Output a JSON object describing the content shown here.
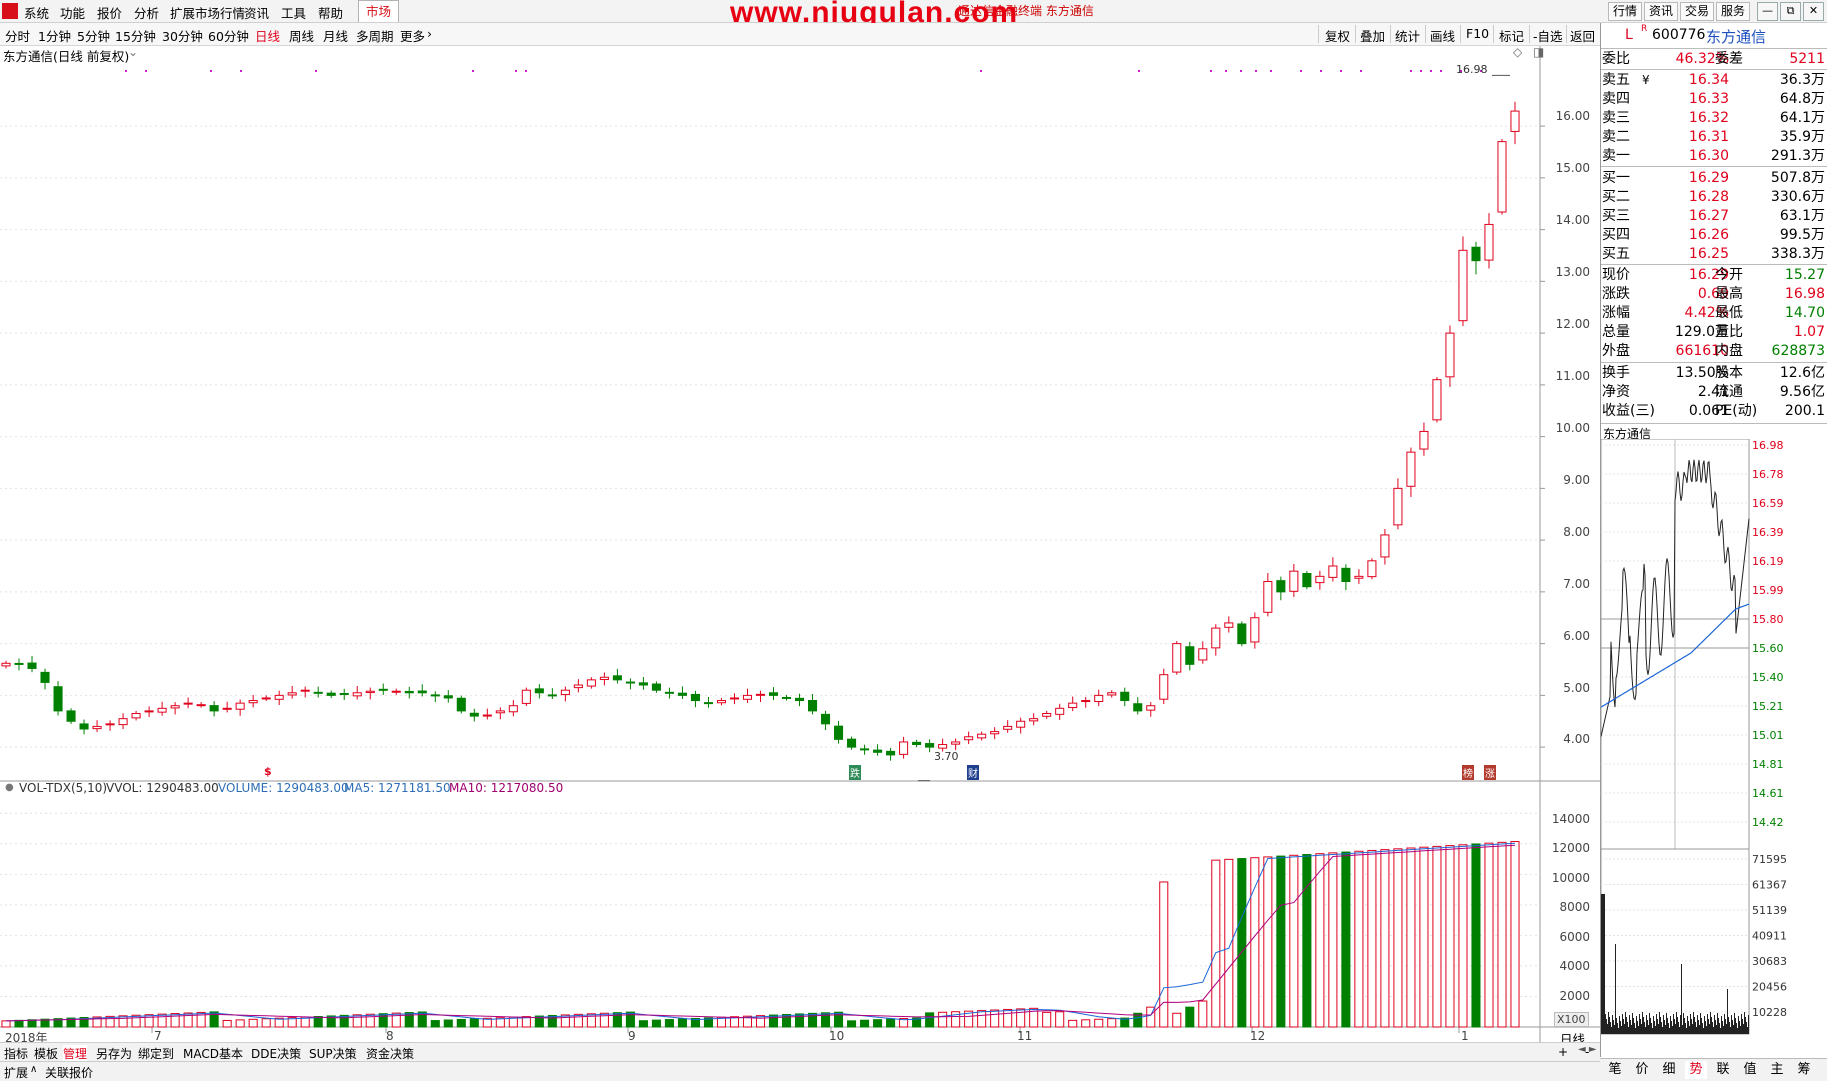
{
  "menu": {
    "items": [
      "系统",
      "功能",
      "报价",
      "分析",
      "扩展市场行情",
      "资讯",
      "工具",
      "帮助"
    ],
    "active_tab": "市场",
    "watermark": "www.niugulan.com",
    "title_text": "通达信金融终端  东方通信",
    "right_buttons": [
      "行情",
      "资讯",
      "交易",
      "服务"
    ],
    "win_buttons": [
      "—",
      "⧉",
      "✕"
    ]
  },
  "toolbar": {
    "periods": [
      "分时",
      "1分钟",
      "5分钟",
      "15分钟",
      "30分钟",
      "60分钟",
      "日线",
      "周线",
      "月线",
      "多周期",
      "更多"
    ],
    "active_period": "日线",
    "more_arrow": "›",
    "right": [
      "复权",
      "叠加",
      "统计",
      "画线",
      "F10",
      "标记",
      "-自选",
      "返回"
    ]
  },
  "chart": {
    "title": "东方通信(日线 前复权)",
    "y_ticks": [
      "16.00",
      "15.00",
      "14.00",
      "13.00",
      "12.00",
      "11.00",
      "10.00",
      "9.00",
      "8.00",
      "7.00",
      "6.00",
      "5.00",
      "4.00"
    ],
    "high_label": "16.98",
    "low_label": "3.70",
    "markers": [
      "$",
      "跌",
      "财",
      "榜",
      "涨"
    ],
    "vol_header": {
      "name": "VOL-TDX(5,10)",
      "vvol": "VVOL: 1290483.00",
      "volume": "VOLUME: 1290483.00",
      "ma5": "MA5: 1271181.50",
      "ma10": "MA10: 1217080.50"
    },
    "vol_ticks": [
      "14000",
      "12000",
      "10000",
      "8000",
      "6000",
      "4000",
      "2000"
    ],
    "vol_unit": "X100",
    "x_labels": [
      "2018年",
      "7",
      "8",
      "9",
      "10",
      "11",
      "12",
      "1"
    ],
    "period_label": "日线"
  },
  "chart_data": {
    "type": "candlestick",
    "title": "东方通信(日线 前复权)",
    "ylim": [
      3.5,
      17.2
    ],
    "months": [
      "2018年6月",
      "7",
      "8",
      "9",
      "10",
      "11",
      "12",
      "2019年1"
    ],
    "high": 16.98,
    "low": 3.7,
    "close_last": 16.29,
    "closes_est": [
      5.62,
      5.6,
      5.52,
      5.25,
      4.7,
      4.5,
      4.35,
      4.4,
      4.45,
      4.55,
      4.65,
      4.7,
      4.75,
      4.8,
      4.85,
      4.82,
      4.7,
      4.75,
      4.85,
      4.9,
      4.95,
      5.0,
      5.05,
      5.1,
      5.05,
      5.0,
      5.02,
      5.05,
      5.08,
      5.1,
      5.08,
      5.05,
      5.05,
      5.0,
      4.95,
      4.7,
      4.6,
      4.62,
      4.7,
      4.8,
      5.1,
      5.05,
      5.0,
      5.1,
      5.2,
      5.3,
      5.35,
      5.3,
      5.25,
      5.2,
      5.1,
      5.05,
      5.0,
      4.9,
      4.85,
      4.9,
      4.95,
      5.0,
      5.02,
      5.0,
      4.95,
      4.9,
      4.7,
      4.45,
      4.15,
      4.0,
      3.95,
      3.9,
      3.85,
      4.1,
      4.05,
      4.0,
      4.05,
      4.1,
      4.2,
      4.25,
      4.3,
      4.4,
      4.5,
      4.55,
      4.65,
      4.75,
      4.85,
      4.9,
      5.0,
      5.05,
      4.9,
      4.7,
      4.8,
      5.4,
      6.0,
      5.6,
      5.9,
      6.3,
      6.4,
      6.0,
      6.5,
      7.2,
      7.0,
      7.4,
      7.1,
      7.3,
      7.5,
      7.2,
      7.3,
      7.6,
      8.1,
      9.0,
      9.7,
      10.1,
      11.1,
      12.0,
      13.6,
      13.4,
      14.1,
      15.7,
      16.29
    ],
    "volume_ma5_last": 1271181.5,
    "volume_ma10_last": 1217080.5,
    "volume_last": 1290483.0,
    "vol_ylim": [
      0,
      15000
    ],
    "ylabel": "",
    "xlabel": ""
  },
  "quote": {
    "code": "600776",
    "name": "东方通信",
    "flag_l": "L",
    "flag_r": "R",
    "webi_label": "委比",
    "webi": "46.32%",
    "wecha_label": "委差",
    "wecha": "5211",
    "sells": [
      {
        "label": "卖五",
        "mark": "¥",
        "price": "16.34",
        "vol": "36.3万"
      },
      {
        "label": "卖四",
        "mark": "",
        "price": "16.33",
        "vol": "64.8万"
      },
      {
        "label": "卖三",
        "mark": "",
        "price": "16.32",
        "vol": "64.1万"
      },
      {
        "label": "卖二",
        "mark": "",
        "price": "16.31",
        "vol": "35.9万"
      },
      {
        "label": "卖一",
        "mark": "",
        "price": "16.30",
        "vol": "291.3万"
      }
    ],
    "buys": [
      {
        "label": "买一",
        "price": "16.29",
        "vol": "507.8万"
      },
      {
        "label": "买二",
        "price": "16.28",
        "vol": "330.6万"
      },
      {
        "label": "买三",
        "price": "16.27",
        "vol": "63.1万"
      },
      {
        "label": "买四",
        "price": "16.26",
        "vol": "99.5万"
      },
      {
        "label": "买五",
        "price": "16.25",
        "vol": "338.3万"
      }
    ],
    "stats": [
      {
        "l1": "现价",
        "v1": "16.29",
        "c1": "red",
        "l2": "今开",
        "v2": "15.27",
        "c2": "green"
      },
      {
        "l1": "涨跌",
        "v1": "0.69",
        "c1": "red",
        "l2": "最高",
        "v2": "16.98",
        "c2": "red"
      },
      {
        "l1": "涨幅",
        "v1": "4.42%",
        "c1": "red",
        "l2": "最低",
        "v2": "14.70",
        "c2": "green"
      },
      {
        "l1": "总量",
        "v1": "129.0万",
        "c1": "black",
        "l2": "量比",
        "v2": "1.07",
        "c2": "red"
      },
      {
        "l1": "外盘",
        "v1": "661610",
        "c1": "red",
        "l2": "内盘",
        "v2": "628873",
        "c2": "green"
      },
      {
        "l1": "换手",
        "v1": "13.50%",
        "c1": "black",
        "l2": "股本",
        "v2": "12.6亿",
        "c2": "black"
      },
      {
        "l1": "净资",
        "v1": "2.41",
        "c1": "black",
        "l2": "流通",
        "v2": "9.56亿",
        "c2": "black"
      },
      {
        "l1": "收益(三)",
        "v1": "0.061",
        "c1": "black",
        "l2": "PE(动)",
        "v2": "200.1",
        "c2": "black"
      }
    ],
    "mini_title": "东方通信",
    "mini_ticks": [
      "16.98",
      "16.78",
      "16.59",
      "16.39",
      "16.19",
      "15.99",
      "15.80",
      "15.60",
      "15.40",
      "15.21",
      "15.01",
      "14.81",
      "14.61",
      "14.42"
    ],
    "mini_vol_ticks": [
      "71595",
      "61367",
      "51139",
      "40911",
      "30683",
      "20456",
      "10228"
    ],
    "tabs": [
      "笔",
      "价",
      "细",
      "势",
      "联",
      "值",
      "主",
      "筹"
    ],
    "active_tab": "势"
  },
  "bottom": {
    "tabs": [
      "指标",
      "模板",
      "管理",
      "另存为",
      "绑定到",
      "MACD基本",
      "DDE决策",
      "SUP决策",
      "资金决策"
    ],
    "active_tab": "管理",
    "status": [
      "扩展",
      "关联报价"
    ],
    "plus": "+",
    "minus": "-",
    "arrows": "◄ ►"
  },
  "colors": {
    "up": "#e0001b",
    "down": "#008000",
    "ma5": "#1a66d8",
    "ma10": "#b0007f",
    "grid": "#c8c8c8"
  }
}
